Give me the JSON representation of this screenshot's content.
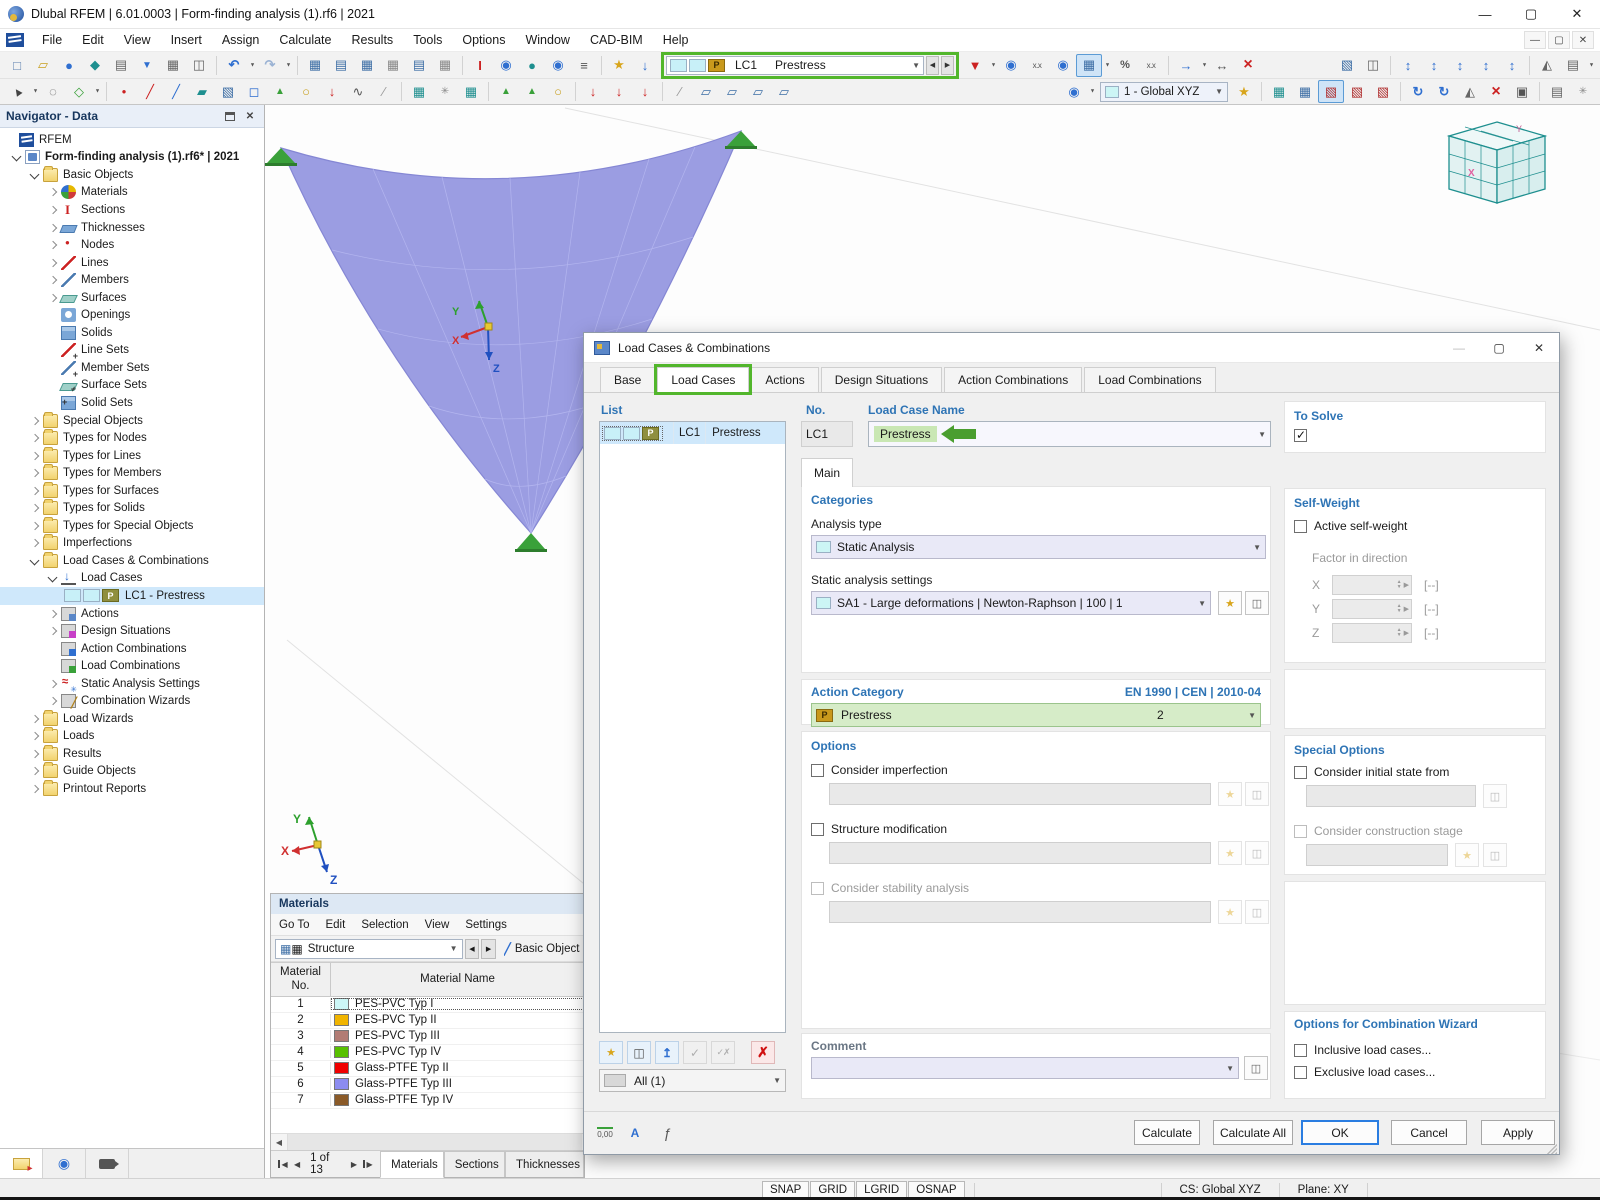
{
  "badges": {
    "p": "P"
  },
  "window": {
    "title": "Dlubal RFEM | 6.01.0003 | Form-finding analysis (1).rf6 | 2021"
  },
  "menubar": {
    "items": [
      "File",
      "Edit",
      "View",
      "Insert",
      "Assign",
      "Calculate",
      "Results",
      "Tools",
      "Options",
      "Window",
      "CAD-BIM",
      "Help"
    ]
  },
  "toolbar": {
    "load_case_selector": {
      "code": "LC1",
      "name": "Prestress"
    },
    "coordinate_system": "1 - Global XYZ"
  },
  "navigator": {
    "title": "Navigator - Data",
    "items": [
      "RFEM",
      "Form-finding analysis (1).rf6* | 2021",
      "Basic Objects",
      "Materials",
      "Sections",
      "Thicknesses",
      "Nodes",
      "Lines",
      "Members",
      "Surfaces",
      "Openings",
      "Solids",
      "Line Sets",
      "Member Sets",
      "Surface Sets",
      "Solid Sets",
      "Special Objects",
      "Types for Nodes",
      "Types for Lines",
      "Types for Members",
      "Types for Surfaces",
      "Types for Solids",
      "Types for Special Objects",
      "Imperfections",
      "Load Cases & Combinations",
      "Load Cases",
      "LC1 - Prestress",
      "Actions",
      "Design Situations",
      "Action Combinations",
      "Load Combinations",
      "Static Analysis Settings",
      "Combination Wizards",
      "Load Wizards",
      "Loads",
      "Results",
      "Guide Objects",
      "Printout Reports"
    ]
  },
  "viewport": {
    "axes": {
      "x": "X",
      "y": "Y",
      "z": "Z"
    }
  },
  "materials_panel": {
    "title": "Materials",
    "menu": [
      "Go To",
      "Edit",
      "Selection",
      "View",
      "Settings"
    ],
    "structure_filter": "Structure",
    "basic_objects_button": "Basic Objects",
    "col_no_line1": "Material",
    "col_no_line2": "No.",
    "col_name": "Material Name",
    "rows": [
      {
        "no": "1",
        "name": "PES-PVC Typ I",
        "color": "#ccf6f6"
      },
      {
        "no": "2",
        "name": "PES-PVC Typ II",
        "color": "#f0b400"
      },
      {
        "no": "3",
        "name": "PES-PVC Typ III",
        "color": "#b27c74"
      },
      {
        "no": "4",
        "name": "PES-PVC Typ IV",
        "color": "#58c000"
      },
      {
        "no": "5",
        "name": "Glass-PTFE Typ II",
        "color": "#f00000"
      },
      {
        "no": "6",
        "name": "Glass-PTFE Typ III",
        "color": "#8c8cf0"
      },
      {
        "no": "7",
        "name": "Glass-PTFE Typ IV",
        "color": "#8a5a28"
      }
    ],
    "pager": "1 of 13",
    "tabs": [
      "Materials",
      "Sections",
      "Thicknesses"
    ]
  },
  "dialog": {
    "title": "Load Cases & Combinations",
    "tabs": [
      "Base",
      "Load Cases",
      "Actions",
      "Design Situations",
      "Action Combinations",
      "Load Combinations"
    ],
    "list": {
      "label": "List",
      "item_code": "LC1",
      "item_name": "Prestress",
      "filter": "All (1)"
    },
    "no_label": "No.",
    "no_value": "LC1",
    "name_label": "Load Case Name",
    "name_value": "Prestress",
    "main_tab": "Main",
    "to_solve_label": "To Solve",
    "categories": {
      "label": "Categories",
      "analysis_type_label": "Analysis type",
      "analysis_type_value": "Static Analysis",
      "settings_label": "Static analysis settings",
      "settings_value": "SA1 - Large deformations | Newton-Raphson | 100 | 1"
    },
    "action_category": {
      "label": "Action Category",
      "standard": "EN 1990 | CEN | 2010-04",
      "value": "Prestress",
      "number": "2"
    },
    "options": {
      "label": "Options",
      "imperfection": "Consider imperfection",
      "structure_modification": "Structure modification",
      "stability": "Consider stability analysis"
    },
    "self_weight": {
      "label": "Self-Weight",
      "active": "Active self-weight",
      "factor": "Factor in direction",
      "x": "X",
      "y": "Y",
      "z": "Z",
      "empty_value": "[--]"
    },
    "special_options": {
      "label": "Special Options",
      "initial_state": "Consider initial state from",
      "construction_stage": "Consider construction stage"
    },
    "combination_wizard": {
      "label": "Options for Combination Wizard",
      "inclusive": "Inclusive load cases...",
      "exclusive": "Exclusive load cases..."
    },
    "comment_label": "Comment",
    "footer_units": "0,00",
    "buttons": {
      "calculate": "Calculate",
      "calculate_all": "Calculate All",
      "ok": "OK",
      "cancel": "Cancel",
      "apply": "Apply"
    }
  },
  "statusbar": {
    "toggles": [
      "SNAP",
      "GRID",
      "LGRID",
      "OSNAP"
    ],
    "cs": "CS: Global XYZ",
    "plane": "Plane: XY"
  },
  "colors": {
    "highlight_green": "#52b62c",
    "annotation_arrow_green": "#4a9e2f",
    "name_highlight_green": "#c9e7b4",
    "action_category_green": "#d6ecc8",
    "selection_blue": "#cfe8fb",
    "membrane_purple": "#9b9de2",
    "badge_gold": "#c9991c"
  }
}
